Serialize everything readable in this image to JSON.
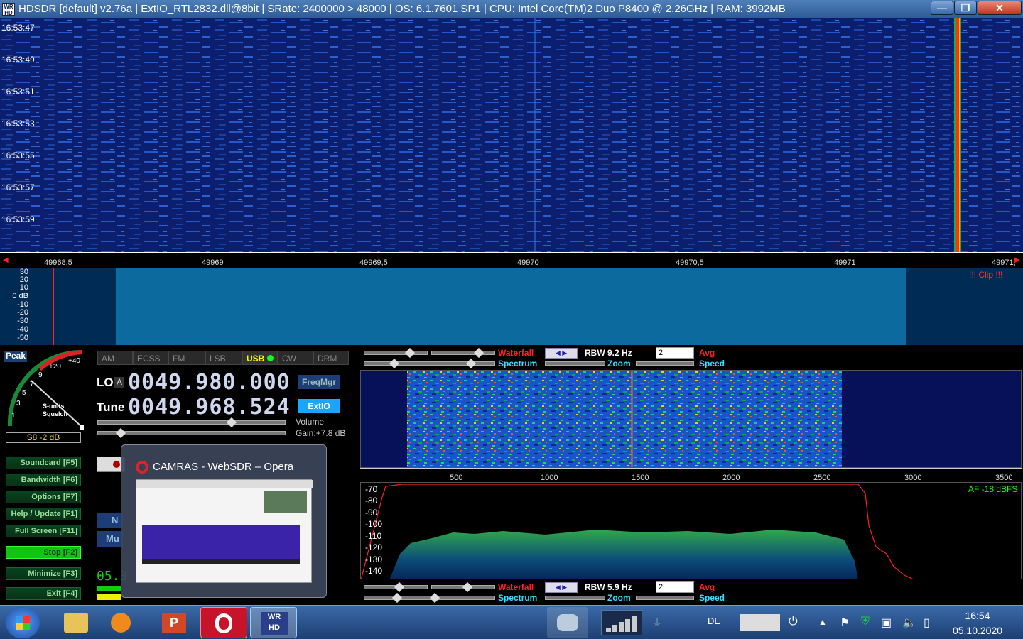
{
  "window": {
    "title": "HDSDR  [default]  v2.76a  |  ExtIO_RTL2832.dll@8bit  |  SRate: 2400000 > 48000  |  OS: 6.1.7601 SP1  |  CPU: Intel Core(TM)2 Duo      P8400  @ 2.26GHz  |  RAM: 3992MB",
    "minimize": "—",
    "restore": "❐",
    "close": "✕"
  },
  "waterfall": {
    "times": [
      "16:53:47",
      "16:53:49",
      "16:53:51",
      "16:53:53",
      "16:53:55",
      "16:53:57",
      "16:53:59"
    ],
    "freq_ticks": [
      "49968,5",
      "49969",
      "49969,5",
      "49970",
      "49970,5",
      "49971",
      "49971,"
    ]
  },
  "spectrum": {
    "db_labels": [
      "30",
      "20",
      "10",
      "0 dB",
      "-10",
      "-20",
      "-30",
      "-40",
      "-50"
    ],
    "clip": "!!! Clip !!!"
  },
  "smeter": {
    "peak_label": "Peak",
    "scale": [
      "+40",
      "+20",
      "9",
      "7",
      "5",
      "3",
      "1"
    ],
    "s_units": "S-units",
    "squelch": "Squelch",
    "reading": "S8 -2 dB"
  },
  "modes": [
    "AM",
    "ECSS",
    "FM",
    "LSB",
    "USB",
    "CW",
    "DRM"
  ],
  "active_mode": "USB",
  "frequency": {
    "lo_label": "LO",
    "lo_a": "A",
    "lo_value": "0049.980.000",
    "tune_label": "Tune",
    "tune_value": "0049.968.524",
    "freqmgr": "FreqMgr",
    "extio": "ExtIO",
    "volume": "Volume",
    "gain": "Gain:+7.8 dB"
  },
  "side_buttons": [
    {
      "label": "Soundcard  [F5]"
    },
    {
      "label": "Bandwidth  [F6]"
    },
    {
      "label": "Options  [F7]"
    },
    {
      "label": "Help / Update  [F1]"
    },
    {
      "label": "Full Screen  [F11]"
    },
    {
      "label": "Stop      [F2]"
    },
    {
      "label": "Minimize  [F3]"
    },
    {
      "label": "Exit      [F4]"
    }
  ],
  "af_top": {
    "waterfall": "Waterfall",
    "spectrum": "Spectrum",
    "rbw": "RBW  9.2 Hz",
    "zoom": "Zoom",
    "avg_value": "2",
    "avg": "Avg",
    "speed": "Speed"
  },
  "af_bottom": {
    "waterfall": "Waterfall",
    "spectrum": "Spectrum",
    "rbw": "RBW  5.9 Hz",
    "zoom": "Zoom",
    "avg_value": "2",
    "avg": "Avg",
    "speed": "Speed"
  },
  "af_axis": [
    "500",
    "1000",
    "1500",
    "2000",
    "2500",
    "3000",
    "3500"
  ],
  "af_db": [
    "-70",
    "-80",
    "-90",
    "-100",
    "-110",
    "-120",
    "-130",
    "-140"
  ],
  "af_level": "AF -18 dBFS",
  "popup": {
    "title": "CAMRAS - WebSDR – Opera"
  },
  "partial_texts": {
    "clock_fragment": "05.3",
    "hidden_n": "N",
    "hidden_mu": "Mu"
  },
  "taskbar": {
    "lang": "DE",
    "input_box": "---",
    "time": "16:54",
    "date": "05.10.2020"
  },
  "colors": {
    "waterfall_bg": "#0b1f6e",
    "spectrum_bg": "#002b55",
    "signal": "#ff3300",
    "accent_red": "#ff2020",
    "accent_cyan": "#33e0ff"
  }
}
